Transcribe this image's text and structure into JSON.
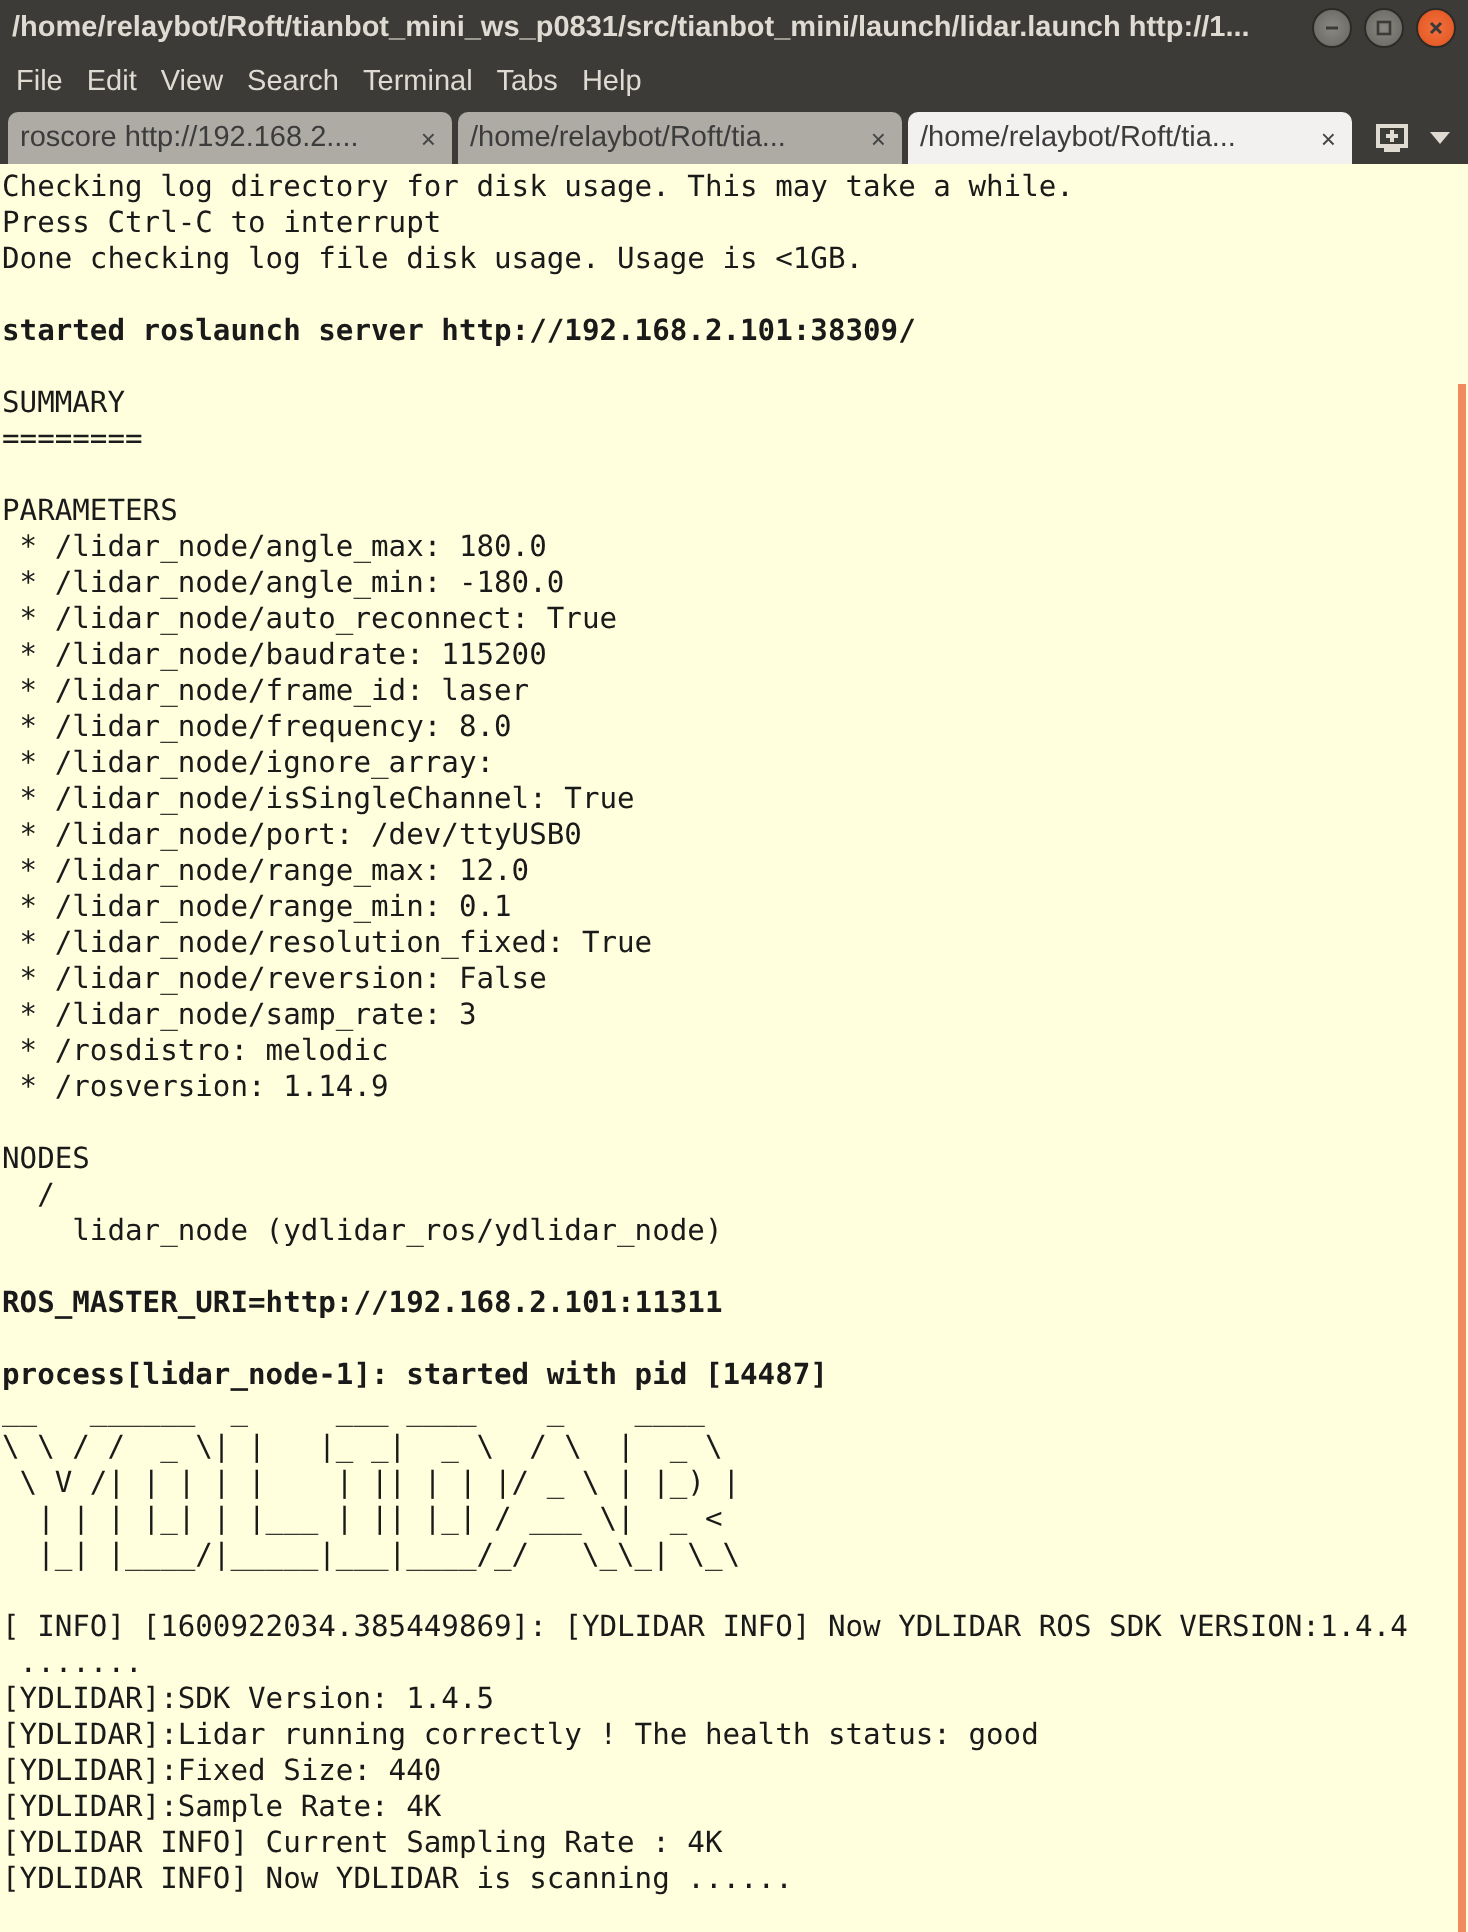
{
  "window": {
    "title": "/home/relaybot/Roft/tianbot_mini_ws_p0831/src/tianbot_mini/launch/lidar.launch http://1..."
  },
  "menu": [
    "File",
    "Edit",
    "View",
    "Search",
    "Terminal",
    "Tabs",
    "Help"
  ],
  "tabs": [
    {
      "label": "roscore http://192.168.2....",
      "close": "×",
      "selected": false
    },
    {
      "label": "/home/relaybot/Roft/tia...",
      "close": "×",
      "selected": false
    },
    {
      "label": "/home/relaybot/Roft/tia...",
      "close": "×",
      "selected": true
    }
  ],
  "terminal": {
    "lines": [
      {
        "kind": "plain",
        "text": "Checking log directory for disk usage. This may take a while."
      },
      {
        "kind": "plain",
        "text": "Press Ctrl-C to interrupt"
      },
      {
        "kind": "plain",
        "text": "Done checking log file disk usage. Usage is <1GB."
      },
      {
        "kind": "blank"
      },
      {
        "kind": "bold",
        "text": "started roslaunch server http://192.168.2.101:38309/"
      },
      {
        "kind": "blank"
      },
      {
        "kind": "plain",
        "text": "SUMMARY"
      },
      {
        "kind": "plain",
        "text": "========"
      },
      {
        "kind": "blank"
      },
      {
        "kind": "plain",
        "text": "PARAMETERS"
      },
      {
        "kind": "plain",
        "text": " * /lidar_node/angle_max: 180.0"
      },
      {
        "kind": "plain",
        "text": " * /lidar_node/angle_min: -180.0"
      },
      {
        "kind": "plain",
        "text": " * /lidar_node/auto_reconnect: True"
      },
      {
        "kind": "plain",
        "text": " * /lidar_node/baudrate: 115200"
      },
      {
        "kind": "plain",
        "text": " * /lidar_node/frame_id: laser"
      },
      {
        "kind": "plain",
        "text": " * /lidar_node/frequency: 8.0"
      },
      {
        "kind": "plain",
        "text": " * /lidar_node/ignore_array:"
      },
      {
        "kind": "plain",
        "text": " * /lidar_node/isSingleChannel: True"
      },
      {
        "kind": "plain",
        "text": " * /lidar_node/port: /dev/ttyUSB0"
      },
      {
        "kind": "plain",
        "text": " * /lidar_node/range_max: 12.0"
      },
      {
        "kind": "plain",
        "text": " * /lidar_node/range_min: 0.1"
      },
      {
        "kind": "plain",
        "text": " * /lidar_node/resolution_fixed: True"
      },
      {
        "kind": "plain",
        "text": " * /lidar_node/reversion: False"
      },
      {
        "kind": "plain",
        "text": " * /lidar_node/samp_rate: 3"
      },
      {
        "kind": "plain",
        "text": " * /rosdistro: melodic"
      },
      {
        "kind": "plain",
        "text": " * /rosversion: 1.14.9"
      },
      {
        "kind": "blank"
      },
      {
        "kind": "plain",
        "text": "NODES"
      },
      {
        "kind": "plain",
        "text": "  /"
      },
      {
        "kind": "plain",
        "text": "    lidar_node (ydlidar_ros/ydlidar_node)"
      },
      {
        "kind": "blank"
      },
      {
        "kind": "bold",
        "text": "ROS_MASTER_URI=http://192.168.2.101:11311"
      },
      {
        "kind": "blank"
      },
      {
        "kind": "bold",
        "text": "process[lidar_node-1]: started with pid [14487]"
      },
      {
        "kind": "art",
        "text": "__   ______  _     ___ ____    _    ____"
      },
      {
        "kind": "art",
        "text": "\\ \\ / /  _ \\| |   |_ _|  _ \\  / \\  |  _ \\"
      },
      {
        "kind": "art",
        "text": " \\ V /| | | | |    | || | | |/ _ \\ | |_) |"
      },
      {
        "kind": "art",
        "text": "  | | | |_| | |___ | || |_| / ___ \\|  _ <"
      },
      {
        "kind": "art",
        "text": "  |_| |____/|_____|___|____/_/   \\_\\_| \\_\\"
      },
      {
        "kind": "blank"
      },
      {
        "kind": "plain",
        "text": "[ INFO] [1600922034.385449869]: [YDLIDAR INFO] Now YDLIDAR ROS SDK VERSION:1.4.4"
      },
      {
        "kind": "plain",
        "text": " ......."
      },
      {
        "kind": "plain",
        "text": "[YDLIDAR]:SDK Version: 1.4.5"
      },
      {
        "kind": "plain",
        "text": "[YDLIDAR]:Lidar running correctly ! The health status: good"
      },
      {
        "kind": "plain",
        "text": "[YDLIDAR]:Fixed Size: 440"
      },
      {
        "kind": "plain",
        "text": "[YDLIDAR]:Sample Rate: 4K"
      },
      {
        "kind": "plain",
        "text": "[YDLIDAR INFO] Current Sampling Rate : 4K"
      },
      {
        "kind": "plain",
        "text": "[YDLIDAR INFO] Now YDLIDAR is scanning ......"
      }
    ]
  }
}
